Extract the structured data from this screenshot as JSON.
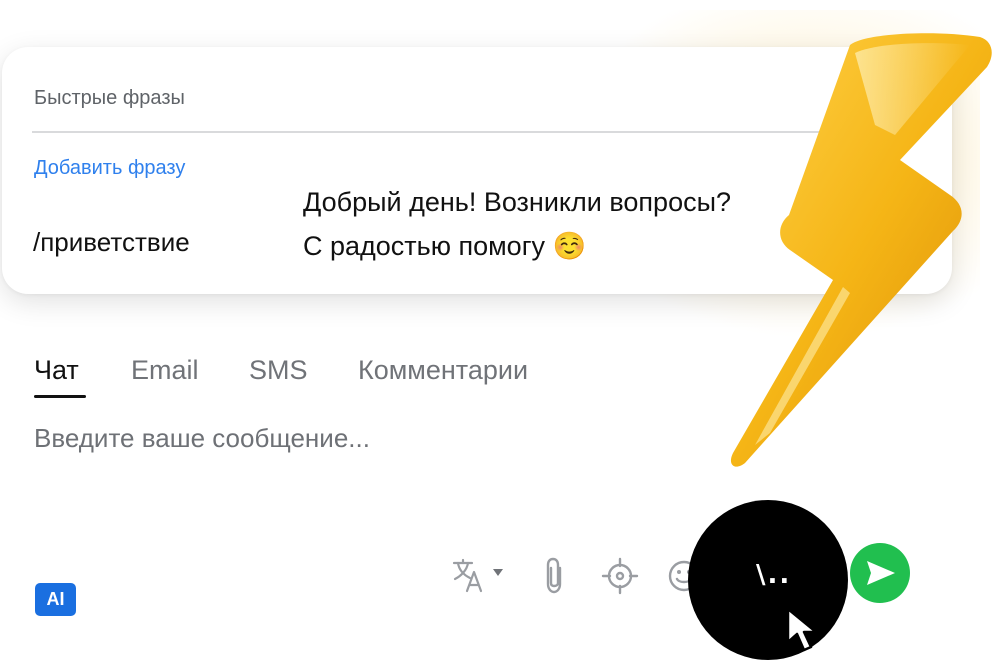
{
  "quick_phrases": {
    "title": "Быстрые фразы",
    "add_label": "Добавить фразу",
    "items": [
      {
        "shortcut": "/приветствие",
        "line1": "Добрый день! Возникли вопросы?",
        "line2": "С радостью помогу ☺️"
      }
    ]
  },
  "tabs": [
    {
      "label": "Чат",
      "active": true
    },
    {
      "label": "Email",
      "active": false
    },
    {
      "label": "SMS",
      "active": false
    },
    {
      "label": "Комментарии",
      "active": false
    }
  ],
  "composer": {
    "placeholder": "Введите ваше сообщение...",
    "ai_label": "AI",
    "slash_hint": "\\.."
  },
  "icons": {
    "translate": "translate-icon",
    "attach": "paperclip-icon",
    "target": "crosshair-icon",
    "emoji": "smile-icon",
    "send": "send-icon",
    "decoration": "lightning-bolt-icon",
    "pointer": "mouse-pointer-icon"
  },
  "colors": {
    "accent_link": "#2f80ed",
    "ai_badge": "#1a6fe0",
    "send_button": "#21bf4f",
    "bolt": "#f2b417"
  }
}
